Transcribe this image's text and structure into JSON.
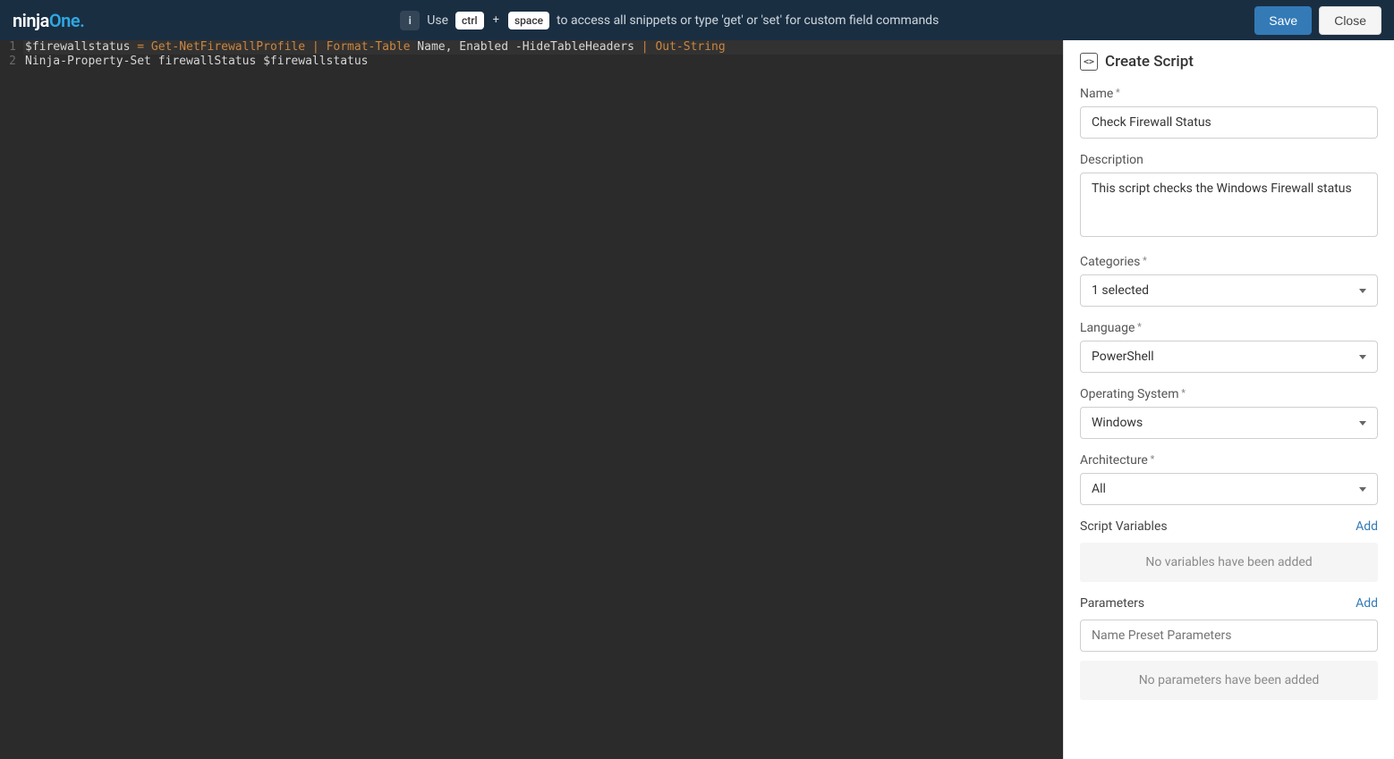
{
  "logo": {
    "part1": "ninja",
    "part2": "One",
    "dot": "."
  },
  "hint": {
    "use": "Use",
    "key1": "ctrl",
    "plus": "+",
    "key2": "space",
    "tail": "to access all snippets or type 'get' or 'set' for custom field commands"
  },
  "buttons": {
    "save": "Save",
    "close": "Close"
  },
  "editor": {
    "lines": [
      {
        "n": "1",
        "hl": true,
        "tokens": [
          {
            "t": "$firewallstatus",
            "c": "tok-var"
          },
          {
            "t": " ",
            "c": ""
          },
          {
            "t": "=",
            "c": "tok-op"
          },
          {
            "t": " ",
            "c": ""
          },
          {
            "t": "Get-NetFirewallProfile",
            "c": "tok-cmd"
          },
          {
            "t": " ",
            "c": ""
          },
          {
            "t": "|",
            "c": "tok-pipe"
          },
          {
            "t": " ",
            "c": ""
          },
          {
            "t": "Format-Table",
            "c": "tok-cmd"
          },
          {
            "t": " Name, Enabled ",
            "c": "tok-prm"
          },
          {
            "t": "-HideTableHeaders",
            "c": "tok-prm"
          },
          {
            "t": " ",
            "c": ""
          },
          {
            "t": "|",
            "c": "tok-pipe"
          },
          {
            "t": " ",
            "c": ""
          },
          {
            "t": "Out-String",
            "c": "tok-cmd"
          }
        ]
      },
      {
        "n": "2",
        "hl": false,
        "tokens": [
          {
            "t": "Ninja-Property-Set firewallStatus $firewallstatus",
            "c": "tok-var"
          }
        ]
      }
    ]
  },
  "panel": {
    "title": "Create Script",
    "name_label": "Name",
    "name_value": "Check Firewall Status",
    "desc_label": "Description",
    "desc_value": "This script checks the Windows Firewall status",
    "cat_label": "Categories",
    "cat_value": "1 selected",
    "lang_label": "Language",
    "lang_value": "PowerShell",
    "os_label": "Operating System",
    "os_value": "Windows",
    "arch_label": "Architecture",
    "arch_value": "All",
    "vars_label": "Script Variables",
    "vars_add": "Add",
    "vars_empty": "No variables have been added",
    "params_label": "Parameters",
    "params_add": "Add",
    "params_placeholder": "Name Preset Parameters",
    "params_empty": "No parameters have been added"
  }
}
